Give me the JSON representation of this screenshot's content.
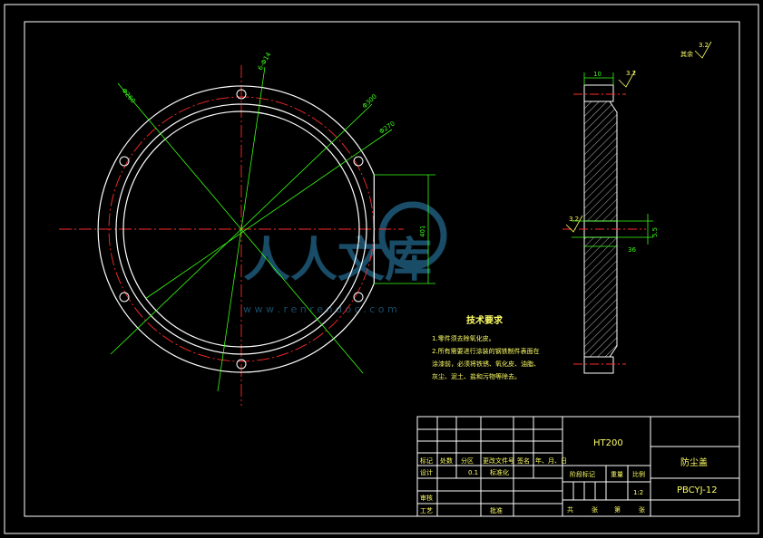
{
  "drawing": {
    "colors": {
      "background": "#000000",
      "frame": "#ffffff",
      "part": "#ffffff",
      "centerline": "#ff2a2a",
      "dimension": "#39ff14",
      "text": "#ffff66",
      "hatch": "#ffffff",
      "watermark": "#1e5a7a"
    },
    "front_view": {
      "dimension_labels": {
        "d_outer": "Φ260",
        "holes": "6-Φ14",
        "d_bolt": "Φ300",
        "d_inner": "Φ270",
        "flat": "401"
      }
    },
    "section_view": {
      "dimension_labels": {
        "thickness": "10",
        "groove": "36",
        "groove_depth": "5.5"
      },
      "roughness_labels": [
        "3.2",
        "3.2"
      ]
    },
    "surface_finish_note": {
      "prefix": "其余",
      "value": "3.2"
    },
    "technical_requirements": {
      "title": "技术要求",
      "items": [
        "1.零件须去除氧化皮。",
        "2.所有需要进行涂装的钢铁制件表面在",
        "涂漆前，必须将铁锈、氧化皮、油脂、",
        "灰尘、泥土、盐和污物等除去。"
      ]
    },
    "watermark": {
      "text": "人人文库",
      "url": "w w w . r e n r e n d o c . c o m"
    },
    "title_block": {
      "material": "HT200",
      "part_name": "防尘盖",
      "drawing_number": "PBCYJ-12",
      "header_row": [
        "标记",
        "处数",
        "分区",
        "更改文件号",
        "签名",
        "年、月、日"
      ],
      "labels": {
        "design": "设计",
        "standardization": "标准化",
        "review": "审核",
        "process": "工艺",
        "approve": "批准",
        "stage_mark": "阶段标记",
        "weight": "重量",
        "scale": "比例",
        "scale_value": "1:2",
        "design_value": "0.1",
        "sheets_total": "共",
        "sheets_word": "张",
        "sheet_no": "第",
        "sheet_word": "张"
      }
    }
  }
}
